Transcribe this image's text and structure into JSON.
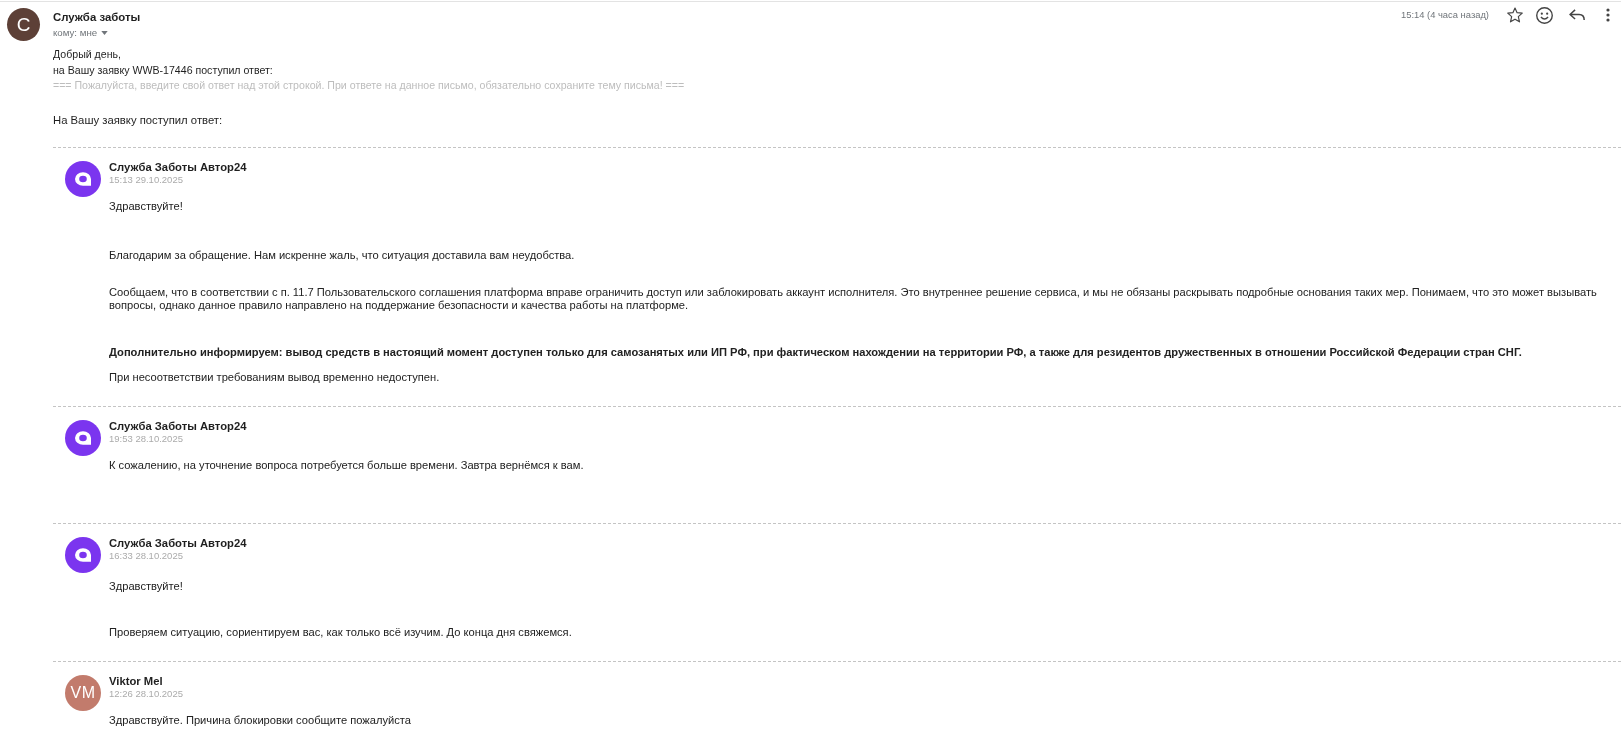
{
  "email": {
    "sender": {
      "initial": "С",
      "name": "Служба заботы"
    },
    "recipient": "кому: мне",
    "time": "15:14 (4 часа назад)",
    "starred": false
  },
  "body": {
    "greeting": "Добрый день,",
    "request_line": "на Вашу заявку WWB-17446 поступил ответ:",
    "reply_marker": "=== Пожалуйста, введите свой ответ над этой строкой. При ответе на данное письмо, обязательно сохраните тему письма! ===",
    "intro": "На Вашу заявку поступил ответ:"
  },
  "replies": [
    {
      "author": "Служба Заботы Автор24",
      "avatar": {
        "kind": "logo"
      },
      "time": "15:13 29.10.2025",
      "paragraphs": [
        {
          "text": "Здравствуйте!",
          "bold": false
        },
        {
          "text": "Благодарим за обращение. Нам искренне жаль, что ситуация доставила вам неудобства.",
          "bold": false
        },
        {
          "text": "Сообщаем, что в соответствии с п. 11.7 Пользовательского соглашения платформа вправе ограничить доступ или заблокировать аккаунт исполнителя. Это внутреннее решение сервиса, и мы не обязаны раскрывать подробные основания таких мер. Понимаем, что это может вызывать вопросы, однако данное правило направлено на поддержание безопасности и качества работы на платформе.",
          "bold": false
        },
        {
          "text": "Дополнительно информируем: вывод средств в настоящий момент доступен только для самозанятых или ИП РФ, при фактическом нахождении на территории РФ, а также для резидентов дружественных в отношении Российской Федерации стран СНГ.",
          "bold": true
        },
        {
          "text": "При несоответствии требованиям вывод временно недоступен.",
          "bold": false
        }
      ]
    },
    {
      "author": "Служба Заботы Автор24",
      "avatar": {
        "kind": "logo"
      },
      "time": "19:53 28.10.2025",
      "paragraphs": [
        {
          "text": "К сожалению, на уточнение вопроса потребуется больше времени. Завтра вернёмся к вам.",
          "bold": false
        }
      ]
    },
    {
      "author": "Служба Заботы Автор24",
      "avatar": {
        "kind": "logo"
      },
      "time": "16:33 28.10.2025",
      "paragraphs": [
        {
          "text": "Здравствуйте!",
          "bold": false
        },
        {
          "text": "Проверяем ситуацию, сориентируем вас, как только всё изучим. До конца дня свяжемся.",
          "bold": false
        }
      ]
    },
    {
      "author": "Viktor Mel",
      "avatar": {
        "kind": "initials",
        "initials": "VM",
        "color": "#c27b6c"
      },
      "time": "12:26 28.10.2025",
      "paragraphs": [
        {
          "text": "Здравствуйте. Причина блокировки сообщите пожалуйста",
          "bold": false
        }
      ]
    }
  ]
}
